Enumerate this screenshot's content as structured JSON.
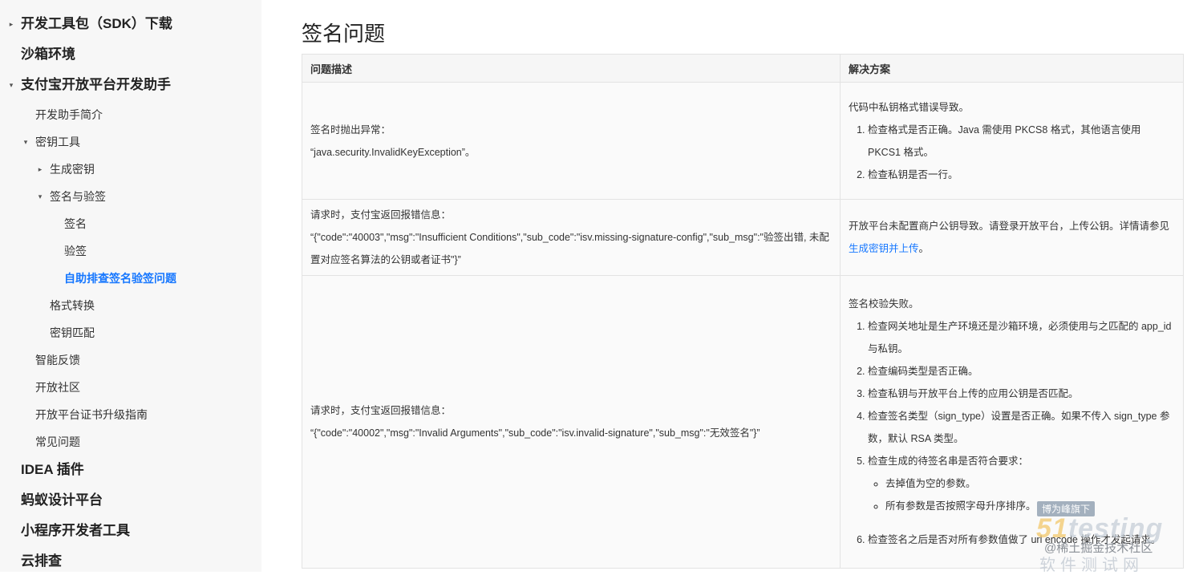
{
  "sidebar": {
    "items": [
      {
        "label": "开发工具包（SDK）下载",
        "arrow": "▸"
      },
      {
        "label": "沙箱环境"
      },
      {
        "label": "支付宝开放平台开发助手",
        "arrow": "▾"
      },
      {
        "label": "开发助手简介"
      },
      {
        "label": "密钥工具",
        "arrow": "▾"
      },
      {
        "label": "生成密钥",
        "arrow": "▸"
      },
      {
        "label": "签名与验签",
        "arrow": "▾"
      },
      {
        "label": "签名"
      },
      {
        "label": "验签"
      },
      {
        "label": "自助排查签名验签问题"
      },
      {
        "label": "格式转换"
      },
      {
        "label": "密钥匹配"
      },
      {
        "label": "智能反馈"
      },
      {
        "label": "开放社区"
      },
      {
        "label": "开放平台证书升级指南"
      },
      {
        "label": "常见问题"
      },
      {
        "label": "IDEA 插件"
      },
      {
        "label": "蚂蚁设计平台"
      },
      {
        "label": "小程序开发者工具"
      },
      {
        "label": "云排查"
      }
    ]
  },
  "main": {
    "title": "签名问题",
    "table": {
      "headers": [
        "问题描述",
        "解决方案"
      ],
      "rows": [
        {
          "problem_lines": [
            "签名时抛出异常：",
            "“java.security.InvalidKeyException”。"
          ],
          "solution_intro": "代码中私钥格式错误导致。",
          "solution_steps": [
            "检查格式是否正确。Java 需使用 PKCS8 格式，其他语言使用 PKCS1 格式。",
            "检查私钥是否一行。"
          ]
        },
        {
          "problem_lines": [
            "请求时，支付宝返回报错信息：",
            "“{\"code\":\"40003\",\"msg\":\"Insufficient Conditions\",\"sub_code\":\"isv.missing-signature-config\",\"sub_msg\":\"验签出错, 未配置对应签名算法的公钥或者证书\"}”"
          ],
          "solution_text": "开放平台未配置商户公钥导致。请登录开放平台，上传公钥。详情请参见",
          "solution_link": "生成密钥并上传",
          "solution_end": "。"
        },
        {
          "problem_lines": [
            "请求时，支付宝返回报错信息：",
            "“{\"code\":\"40002\",\"msg\":\"Invalid Arguments\",\"sub_code\":\"isv.invalid-signature\",\"sub_msg\":\"无效签名\"}”"
          ],
          "solution_intro": "签名校验失败。",
          "solution_steps": [
            "检查网关地址是生产环境还是沙箱环境，必须使用与之匹配的 app_id 与私钥。",
            "检查编码类型是否正确。",
            "检查私钥与开放平台上传的应用公钥是否匹配。",
            "检查签名类型（sign_type）设置是否正确。如果不传入 sign_type 参数，默认 RSA 类型。",
            "检查生成的待签名串是否符合要求："
          ],
          "solution_subitems": [
            "去掉值为空的参数。",
            "所有参数是否按照字母升序排序。"
          ],
          "solution_step6": "检查签名之后是否对所有参数值做了 url encode 操作才发起请求。"
        }
      ]
    }
  },
  "watermark": {
    "badge": "博为峰旗下",
    "logo_a": "51",
    "logo_b": "testing",
    "juejin": "@稀土掘金技术社区",
    "cn": "软件测试网"
  }
}
